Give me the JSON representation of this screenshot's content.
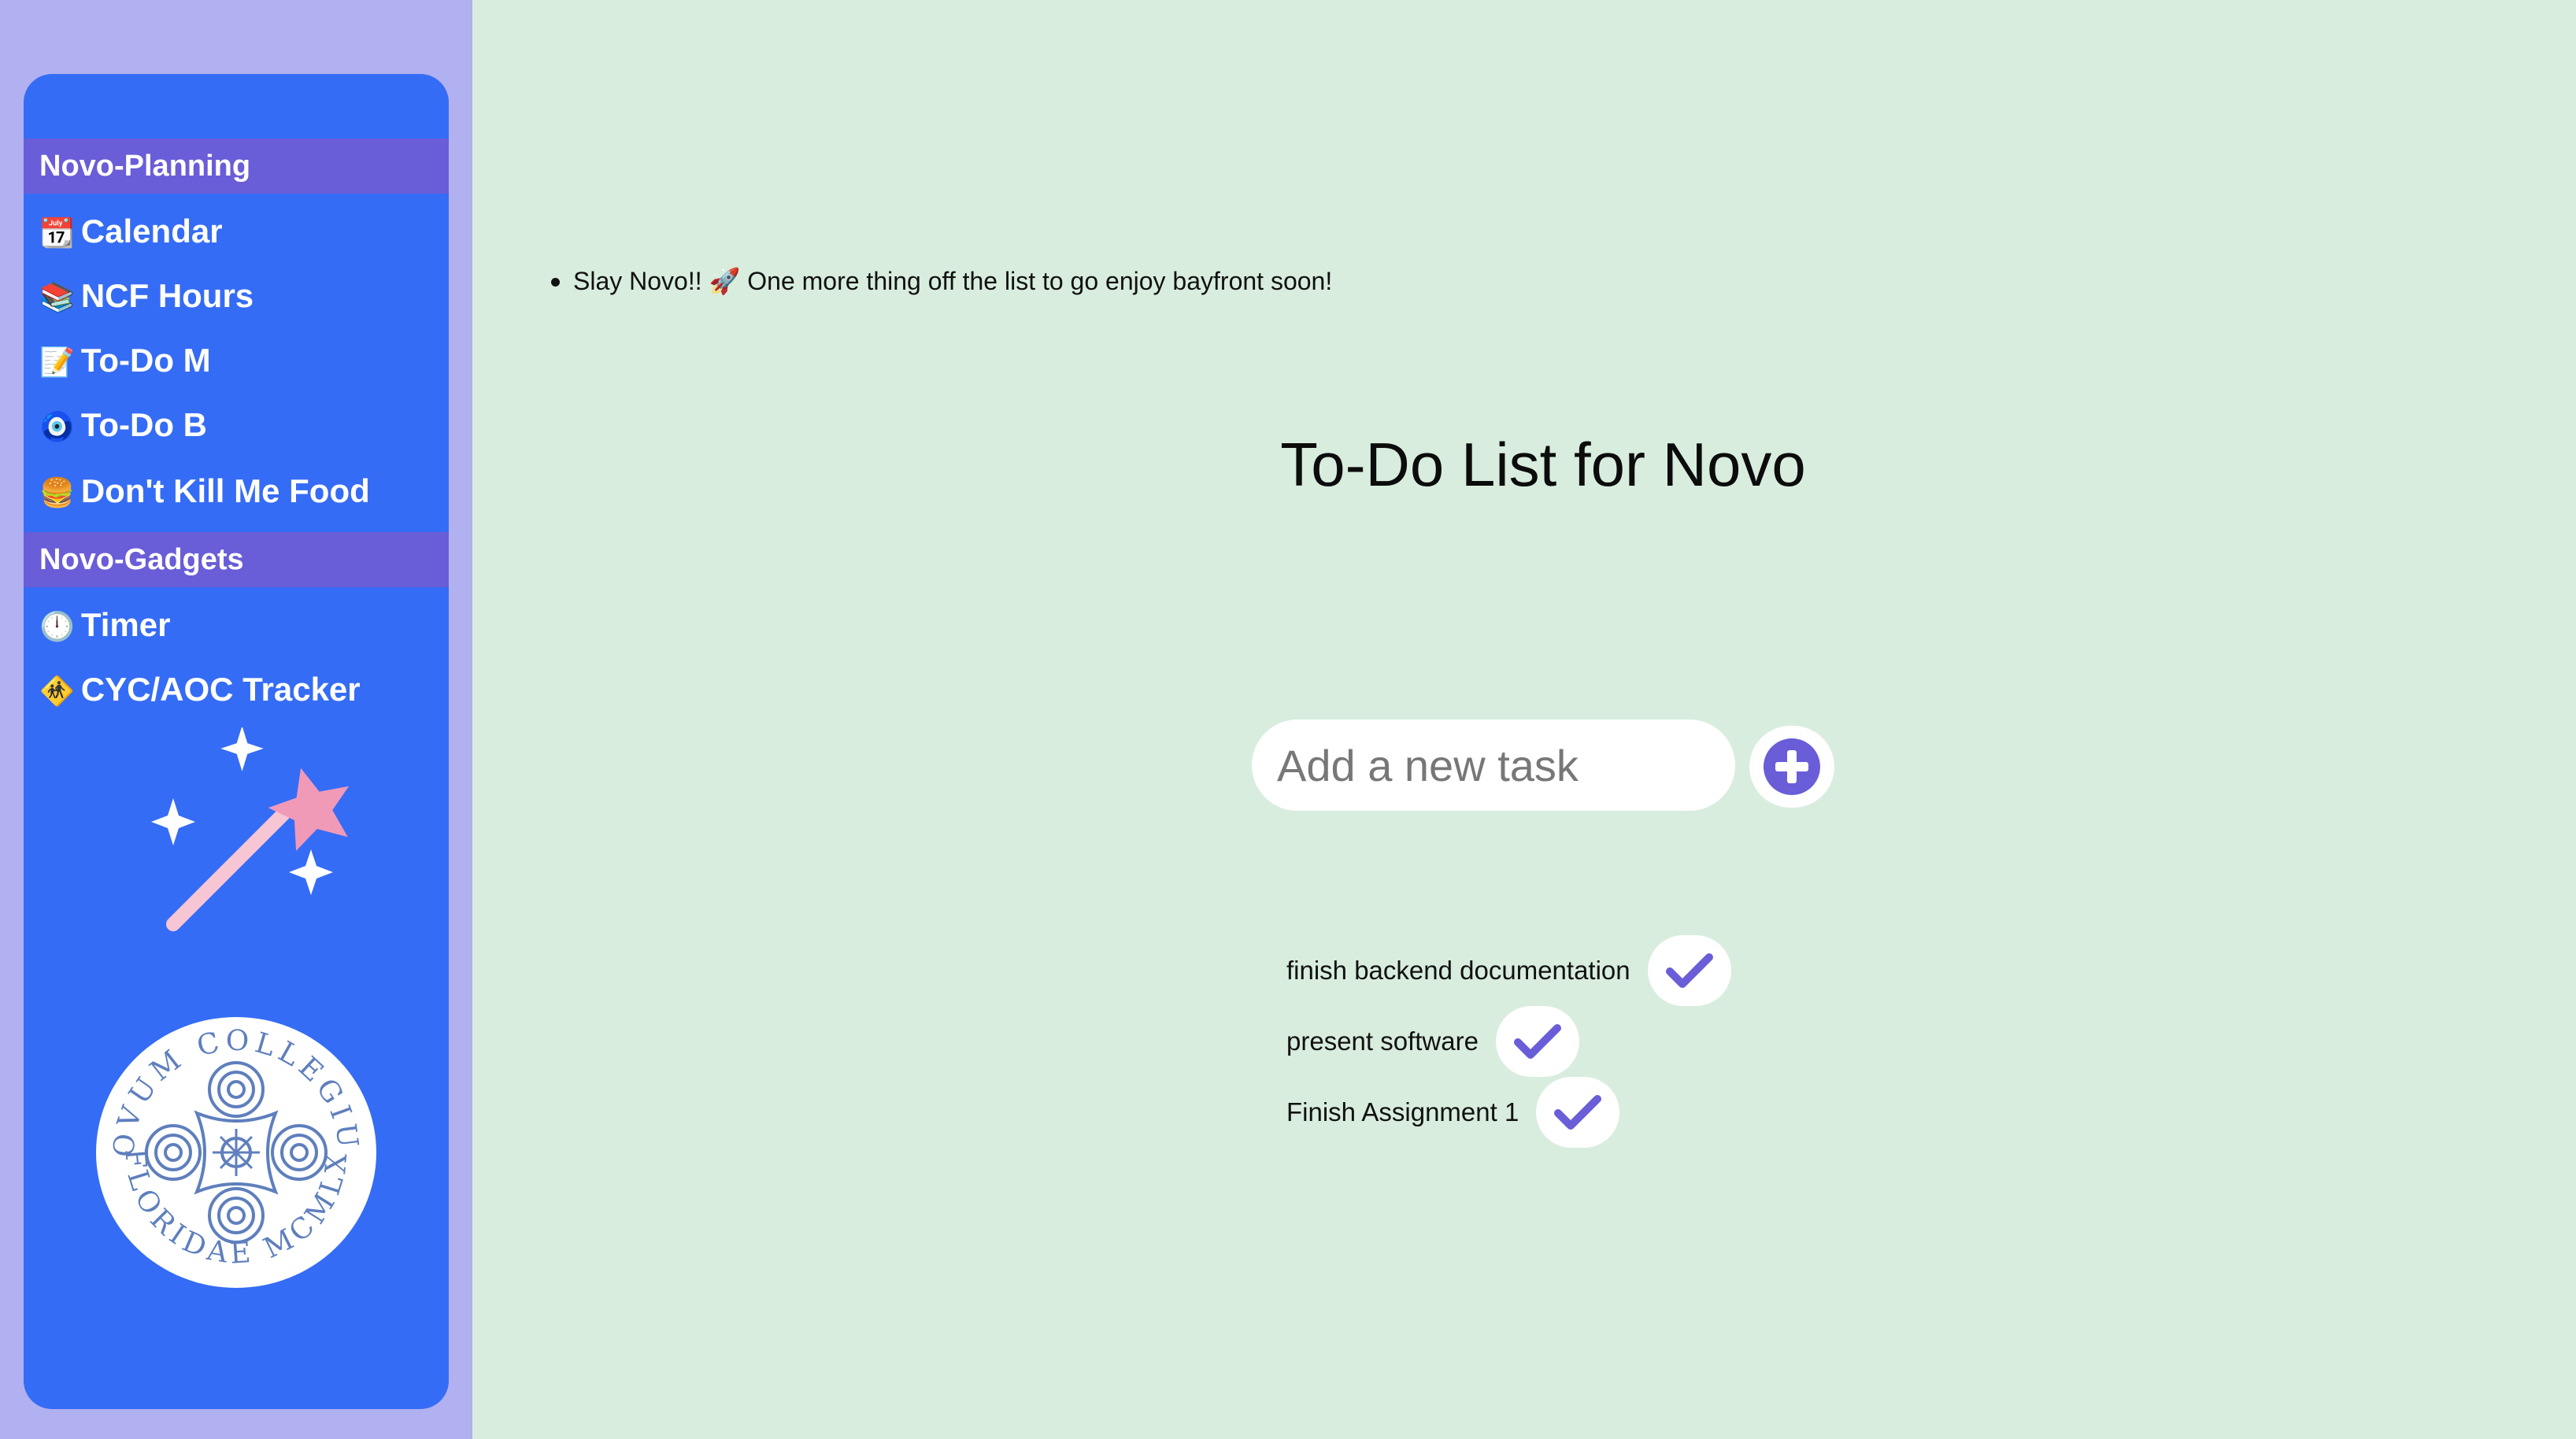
{
  "sidebar": {
    "sections": [
      {
        "title": "Novo-Planning",
        "items": [
          {
            "icon": "📆",
            "label": "Calendar"
          },
          {
            "icon": "📚",
            "label": "NCF Hours"
          },
          {
            "icon": "📝",
            "label": "To-Do M"
          },
          {
            "icon": "🧿",
            "label": "To-Do B"
          },
          {
            "icon": "🍔",
            "label": "Don't Kill Me Food"
          }
        ]
      },
      {
        "title": "Novo-Gadgets",
        "items": [
          {
            "icon": "🕛",
            "label": "Timer"
          },
          {
            "icon": "🚸",
            "label": "CYC/AOC Tracker"
          }
        ]
      }
    ],
    "seal_text_top": "NOVUM COLLEGIUM",
    "seal_text_bottom": "FLORIDAE MCMLX"
  },
  "main": {
    "banner": {
      "text_before": "Slay Novo!! ",
      "emoji": "🚀",
      "text_after": " One more thing off the list to go enjoy bayfront soon!"
    },
    "title": "To-Do List for Novo",
    "input": {
      "placeholder": "Add a new task",
      "value": ""
    },
    "tasks": [
      {
        "text": "finish backend documentation"
      },
      {
        "text": "present software"
      },
      {
        "text": "Finish Assignment 1"
      }
    ]
  },
  "colors": {
    "page_bg": "#d8edde",
    "sidebar_outer": "#b1b0f0",
    "sidebar_panel": "#356cf5",
    "section_header": "#6a5dd8",
    "accent_purple": "#6a5dd8",
    "wand_star": "#f09ab8",
    "wand_stick": "#f7c6d4",
    "seal_blue": "#5f7fbd"
  }
}
